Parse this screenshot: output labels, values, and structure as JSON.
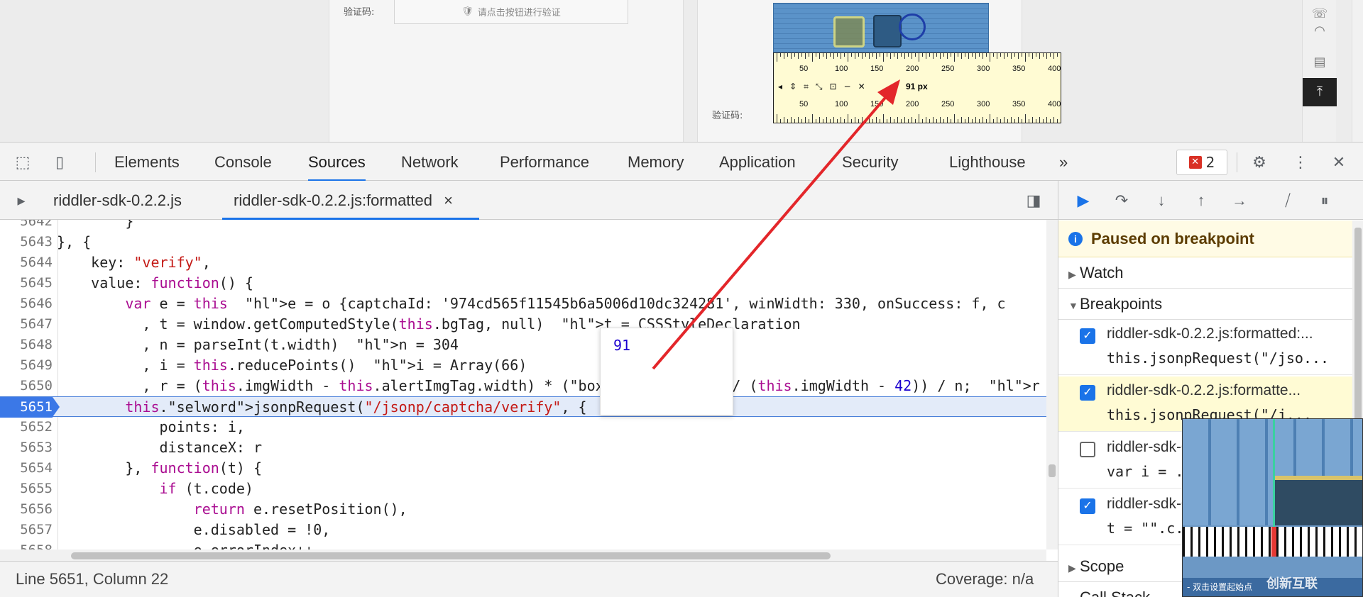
{
  "page": {
    "verify_label_1": "验证码:",
    "verify_label_2": "验证码:",
    "captcha_button": "请点击按钮进行验证",
    "ruler": {
      "ticks": [
        "50",
        "100",
        "150",
        "200",
        "250",
        "300",
        "350",
        "400"
      ],
      "measure": "91 px"
    }
  },
  "toolbar": {
    "panels": [
      "Elements",
      "Console",
      "Sources",
      "Network",
      "Performance",
      "Memory",
      "Application",
      "Security",
      "Lighthouse"
    ],
    "more": "»",
    "error_count": "2"
  },
  "file_tabs": {
    "tab1": "riddler-sdk-0.2.2.js",
    "tab2": "riddler-sdk-0.2.2.js:formatted",
    "close": "×"
  },
  "code_lines": [
    {
      "ln": "5642",
      "text": "        }"
    },
    {
      "ln": "5643",
      "text": "}, {"
    },
    {
      "ln": "5644",
      "text": "    key: \"verify\","
    },
    {
      "ln": "5645",
      "text": "    value: function() {"
    },
    {
      "ln": "5646",
      "text": "        var e = this  e = o {captchaId: '974cd565f11545b6a5006d10dc324281', winWidth: 330, onSuccess: f, c"
    },
    {
      "ln": "5647",
      "text": "          , t = window.getComputedStyle(this.bgTag, null)  t = CSSStyleDeclaration"
    },
    {
      "ln": "5648",
      "text": "          , n = parseInt(t.width)  n = 304"
    },
    {
      "ln": "5649",
      "text": "          , i = this.reducePoints()  i = Array(66)"
    },
    {
      "ln": "5650",
      "text": "          , r = (this.imgWidth - this.alertImgTag.width) * (this.offsetX / (this.imgWidth - 42)) / n;  r ="
    },
    {
      "ln": "5651",
      "text": "        this.jsonpRequest(\"/jsonp/captcha/verify\", {"
    },
    {
      "ln": "5652",
      "text": "            points: i,"
    },
    {
      "ln": "5653",
      "text": "            distanceX: r"
    },
    {
      "ln": "5654",
      "text": "        }, function(t) {"
    },
    {
      "ln": "5655",
      "text": "            if (t.code)"
    },
    {
      "ln": "5656",
      "text": "                return e.resetPosition(),"
    },
    {
      "ln": "5657",
      "text": "                e.disabled = !0,"
    },
    {
      "ln": "5658",
      "text": "                e.errorIndex++"
    }
  ],
  "tooltip": {
    "value": "91"
  },
  "status": {
    "position": "Line 5651, Column 22",
    "coverage": "Coverage: n/a"
  },
  "debugger": {
    "paused": "Paused on breakpoint",
    "watch": "Watch",
    "breakpoints_header": "Breakpoints",
    "breakpoints": [
      {
        "file": "riddler-sdk-0.2.2.js:formatted:...",
        "code": "this.jsonpRequest(\"/jso...",
        "checked": true
      },
      {
        "file": "riddler-sdk-0.2.2.js:formatte...",
        "code": "this.jsonpRequest(\"/j...",
        "checked": true
      },
      {
        "file": "riddler-sdk-0.2.2.js:formatted...",
        "code": "var i = ...",
        "checked": false
      },
      {
        "file": "riddler-sdk-0.2.2.js:formatted...",
        "code": "t = \"\".c...",
        "checked": true
      }
    ],
    "scope": "Scope",
    "call_stack": "Call Stack"
  },
  "magnifier": {
    "hint": "- 双击设置起始点",
    "brand": "创新互联"
  },
  "colors": {
    "accent": "#1a73e8",
    "arrow": "#e3262a",
    "paused_bg": "#fffbe5"
  }
}
